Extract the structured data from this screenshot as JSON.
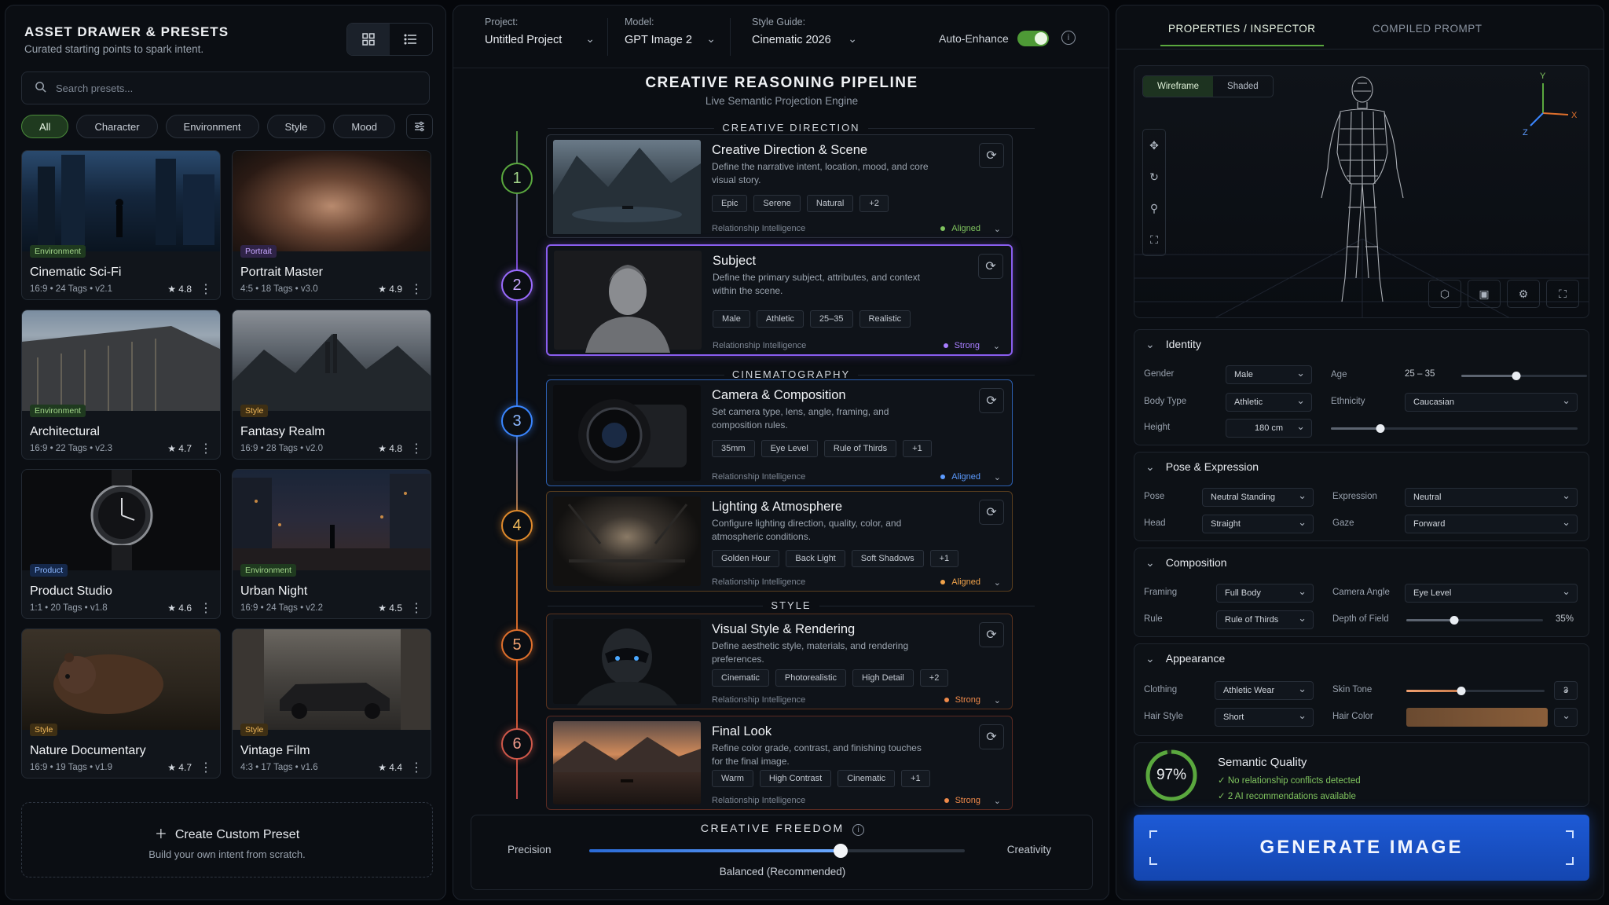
{
  "assets": {
    "title": "ASSET DRAWER & PRESETS",
    "subtitle": "Curated starting points to spark intent.",
    "search_placeholder": "Search presets...",
    "filters": [
      "All",
      "Character",
      "Environment",
      "Style",
      "Mood"
    ],
    "presets": [
      {
        "tag": "Environment",
        "title": "Cinematic Sci-Fi",
        "meta": "16:9 • 24 Tags • v2.1",
        "rating": "★ 4.8"
      },
      {
        "tag": "Portrait",
        "title": "Portrait Master",
        "meta": "4:5 • 18 Tags • v3.0",
        "rating": "★ 4.9"
      },
      {
        "tag": "Environment",
        "title": "Architectural",
        "meta": "16:9 • 22 Tags • v2.3",
        "rating": "★ 4.7"
      },
      {
        "tag": "Style",
        "title": "Fantasy Realm",
        "meta": "16:9 • 28 Tags • v2.0",
        "rating": "★ 4.8"
      },
      {
        "tag": "Product",
        "title": "Product Studio",
        "meta": "1:1 • 20 Tags • v1.8",
        "rating": "★ 4.6"
      },
      {
        "tag": "Environment",
        "title": "Urban Night",
        "meta": "16:9 • 24 Tags • v2.2",
        "rating": "★ 4.5"
      },
      {
        "tag": "Style",
        "title": "Nature Documentary",
        "meta": "16:9 • 19 Tags • v1.9",
        "rating": "★ 4.7"
      },
      {
        "tag": "Style",
        "title": "Vintage Film",
        "meta": "4:3 • 17 Tags • v1.6",
        "rating": "★ 4.4"
      }
    ],
    "custom_title": "Create Custom Preset",
    "custom_sub": "Build your own intent from scratch."
  },
  "topbar": {
    "project_label": "Project:",
    "project_value": "Untitled Project",
    "model_label": "Model:",
    "model_value": "GPT Image 2",
    "style_label": "Style Guide:",
    "style_value": "Cinematic 2026",
    "auto_enhance": "Auto-Enhance"
  },
  "pipeline": {
    "title": "CREATIVE REASONING PIPELINE",
    "subtitle": "Live Semantic Projection Engine",
    "sections": [
      "CREATIVE DIRECTION",
      "CINEMATOGRAPHY",
      "STYLE"
    ],
    "ri_label": "Relationship Intelligence",
    "steps": [
      {
        "num": "1",
        "title": "Creative Direction & Scene",
        "desc": "Define the narrative intent, location, mood, and core visual story.",
        "tags": [
          "Epic",
          "Serene",
          "Natural",
          "+2"
        ],
        "status": "Aligned",
        "color": "#5aa83e"
      },
      {
        "num": "2",
        "title": "Subject",
        "desc": "Define the primary subject, attributes, and context within the scene.",
        "tags": [
          "Male",
          "Athletic",
          "25–35",
          "Realistic"
        ],
        "status": "Strong",
        "color": "#9b6bff"
      },
      {
        "num": "3",
        "title": "Camera & Composition",
        "desc": "Set camera type, lens, angle, framing, and composition rules.",
        "tags": [
          "35mm",
          "Eye Level",
          "Rule of Thirds",
          "+1"
        ],
        "status": "Aligned",
        "color": "#3a86ff"
      },
      {
        "num": "4",
        "title": "Lighting & Atmosphere",
        "desc": "Configure lighting direction, quality, color, and atmospheric conditions.",
        "tags": [
          "Golden Hour",
          "Back Light",
          "Soft Shadows",
          "+1"
        ],
        "status": "Aligned",
        "color": "#e08a2c"
      },
      {
        "num": "5",
        "title": "Visual Style & Rendering",
        "desc": "Define aesthetic style, materials, and rendering preferences.",
        "tags": [
          "Cinematic",
          "Photorealistic",
          "High Detail",
          "+2"
        ],
        "status": "Strong",
        "color": "#e0702c"
      },
      {
        "num": "6",
        "title": "Final Look",
        "desc": "Refine color grade, contrast, and finishing touches for the final image.",
        "tags": [
          "Warm",
          "High Contrast",
          "Cinematic",
          "+1"
        ],
        "status": "Strong",
        "color": "#d0584a"
      }
    ],
    "freedom": {
      "title": "CREATIVE FREEDOM",
      "left": "Precision",
      "right": "Creativity",
      "value_label": "Balanced (Recommended)",
      "value": 0.67
    }
  },
  "inspector": {
    "tabs": [
      "PROPERTIES / INSPECTOR",
      "COMPILED PROMPT"
    ],
    "view_modes": [
      "Wireframe",
      "Shaded"
    ],
    "identity": {
      "title": "Identity",
      "gender_l": "Gender",
      "gender": "Male",
      "age_l": "Age",
      "age": "25 – 35",
      "body_l": "Body Type",
      "body": "Athletic",
      "eth_l": "Ethnicity",
      "eth": "Caucasian",
      "height_l": "Height",
      "height": "180 cm"
    },
    "pose": {
      "title": "Pose & Expression",
      "pose_l": "Pose",
      "pose": "Neutral Standing",
      "expr_l": "Expression",
      "expr": "Neutral",
      "head_l": "Head",
      "head": "Straight",
      "gaze_l": "Gaze",
      "gaze": "Forward"
    },
    "comp": {
      "title": "Composition",
      "framing_l": "Framing",
      "framing": "Full Body",
      "angle_l": "Camera Angle",
      "angle": "Eye Level",
      "rule_l": "Rule",
      "rule": "Rule of Thirds",
      "dof_l": "Depth of Field",
      "dof": "35%"
    },
    "appear": {
      "title": "Appearance",
      "cloth_l": "Clothing",
      "cloth": "Athletic Wear",
      "skin_l": "Skin Tone",
      "skin": "3",
      "hair_l": "Hair Style",
      "hair": "Short",
      "haircol_l": "Hair Color"
    },
    "quality": {
      "pct": "97%",
      "title": "Semantic Quality",
      "l1": "No relationship conflicts detected",
      "l2": "2 AI recommendations available"
    },
    "generate": "GENERATE IMAGE"
  }
}
